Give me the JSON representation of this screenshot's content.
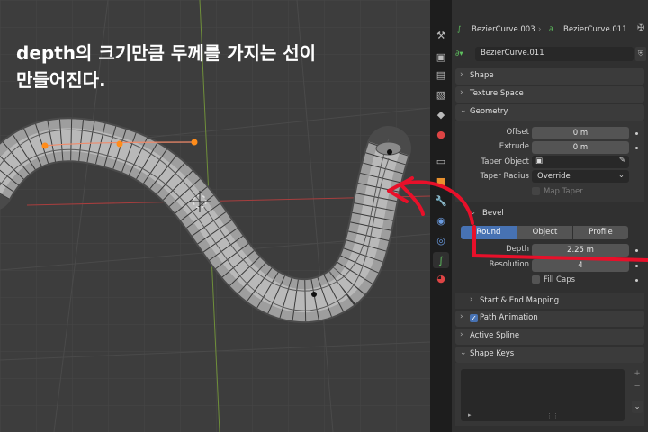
{
  "caption": {
    "line1": "depth의 크기만큼 두께를 가지는 선이",
    "line2": "만들어진다."
  },
  "header": {
    "object_name": "BezierCurve.003",
    "data_name": "BezierCurve.011",
    "datablock_field": "BezierCurve.011"
  },
  "panels": {
    "shape": "Shape",
    "texture_space": "Texture Space",
    "geometry": "Geometry",
    "bevel": "Bevel",
    "start_end": "Start & End Mapping",
    "path_animation": "Path Animation",
    "active_spline": "Active Spline",
    "shape_keys": "Shape Keys"
  },
  "geometry": {
    "offset_label": "Offset",
    "offset_value": "0 m",
    "extrude_label": "Extrude",
    "extrude_value": "0 m",
    "taper_object_label": "Taper Object",
    "taper_radius_label": "Taper Radius",
    "taper_radius_value": "Override",
    "map_taper_label": "Map Taper"
  },
  "bevel": {
    "modes": [
      "Round",
      "Object",
      "Profile"
    ],
    "active_mode": "Round",
    "depth_label": "Depth",
    "depth_value": "2.25 m",
    "resolution_label": "Resolution",
    "resolution_value": "4",
    "fill_caps_label": "Fill Caps"
  },
  "path_animation_checked": true,
  "colors": {
    "accent": "#4772b3",
    "annotation": "#e8102a",
    "handle": "#ff8c1a",
    "curve": "#f08a6a"
  }
}
